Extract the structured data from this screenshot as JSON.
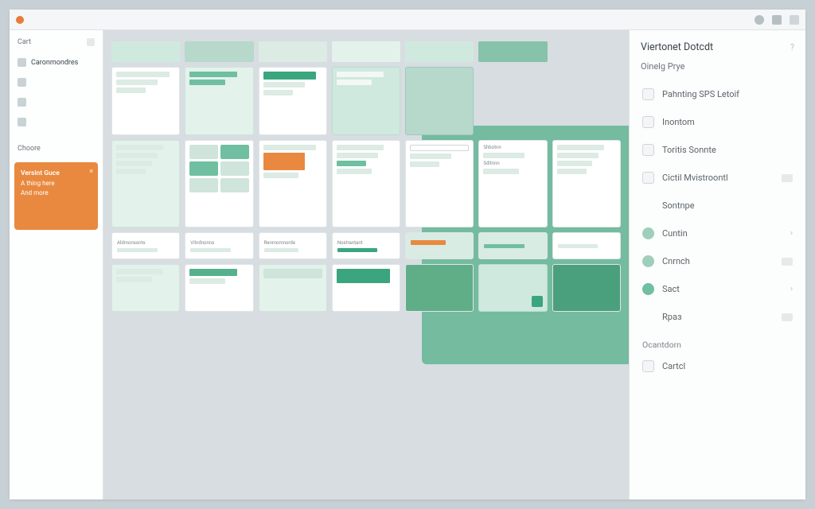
{
  "titlebar": {
    "app": ""
  },
  "sidebar": {
    "header": "Cart",
    "items": [
      {
        "label": "Caronmondres"
      },
      {
        "label": ""
      },
      {
        "label": ""
      },
      {
        "label": ""
      }
    ],
    "section": "Choore",
    "promo": {
      "title": "Versint Guce",
      "line1": "A thing here",
      "line2": "And more"
    }
  },
  "panel": {
    "title": "Viertonet Dotcdt",
    "subtitle": "Oinelg Prye",
    "items": [
      {
        "label": "Pahnting SPS Letoif"
      },
      {
        "label": "Inontom"
      },
      {
        "label": "Toritis Sonnte"
      },
      {
        "label": "Cictil Mvistroontl"
      },
      {
        "label": "Sontnpe"
      },
      {
        "label": "Cuntin"
      },
      {
        "label": "Cnrnch"
      },
      {
        "label": "Sact"
      },
      {
        "label": "Rраз"
      }
    ],
    "section2": "Ocantdorn",
    "section2_items": [
      {
        "label": "Cartcl"
      }
    ]
  },
  "thumbs": {
    "row2": [
      "",
      "",
      "",
      "",
      "",
      "",
      ""
    ],
    "row3": [
      "Aldmonsonts",
      "Vilndnonns",
      "Renmomnorde",
      "Nostrantant",
      "",
      "",
      ""
    ]
  }
}
